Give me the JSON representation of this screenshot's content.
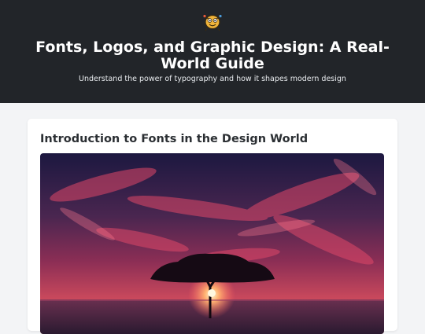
{
  "header": {
    "logo_icon": "cartoon-mascot-icon",
    "title": "Fonts, Logos, and Graphic Design: A Real-World Guide",
    "subtitle": "Understand the power of typography and how it shapes modern design"
  },
  "article": {
    "heading": "Introduction to Fonts in the Design World",
    "hero_image": "tree-silhouette-sunset-photo"
  },
  "colors": {
    "header_bg": "#222529",
    "page_bg": "#f3f4f6",
    "card_bg": "#ffffff",
    "sky_accent": "#d83a5a"
  }
}
